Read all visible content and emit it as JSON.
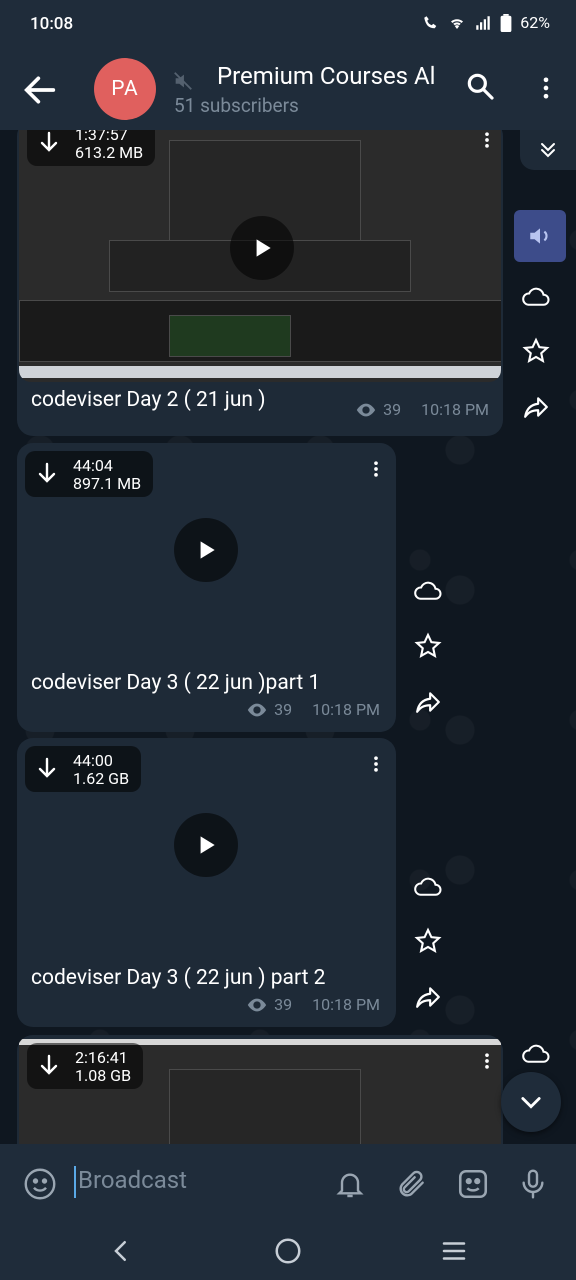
{
  "status_bar": {
    "time": "10:08",
    "battery": "62%"
  },
  "header": {
    "avatar_initials": "PA",
    "title": "Premium Courses Al",
    "subtitle": "51 subscribers"
  },
  "messages": [
    {
      "duration": "1:37:57",
      "size": "613.2 MB",
      "caption": "codeviser Day 2 ( 21 jun )",
      "views": "39",
      "time": "10:18 PM"
    },
    {
      "duration": "44:04",
      "size": "897.1 MB",
      "caption": "codeviser Day 3  ( 22 jun )part 1",
      "views": "39",
      "time": "10:18 PM"
    },
    {
      "duration": "44:00",
      "size": "1.62 GB",
      "caption": "codeviser Day 3  ( 22 jun ) part 2",
      "views": "39",
      "time": "10:18 PM"
    },
    {
      "duration": "2:16:41",
      "size": "1.08 GB"
    }
  ],
  "input": {
    "placeholder": "Broadcast"
  },
  "icons": {
    "back": "arrow-left-icon",
    "mute": "muted-icon",
    "search": "search-icon",
    "menu": "more-vertical-icon",
    "download": "download-icon",
    "play": "play-icon",
    "cloud": "cloud-icon",
    "star": "star-icon",
    "share": "share-icon",
    "views": "eye-icon",
    "emoji": "emoji-icon",
    "bell": "bell-icon",
    "attach": "paperclip-icon",
    "sticker": "sticker-icon",
    "mic": "mic-icon"
  },
  "colors": {
    "bar": "#1f2c3a",
    "bubble": "#1e2a37",
    "avatar": "#e0605e",
    "accent": "#5aa9e6"
  }
}
